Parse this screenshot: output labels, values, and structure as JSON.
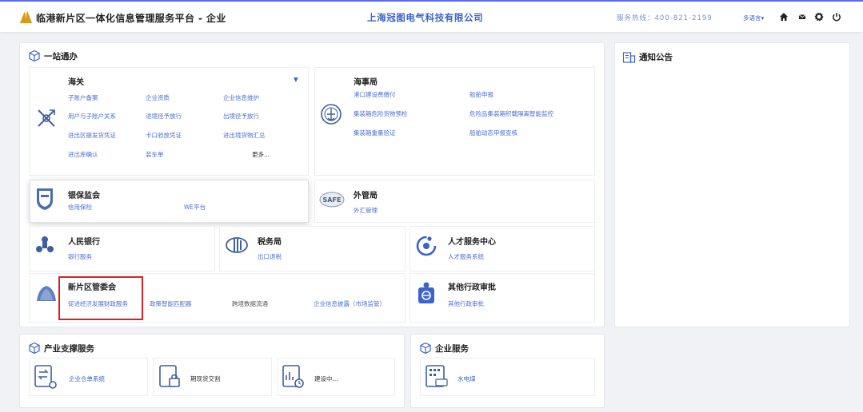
{
  "header": {
    "platform_title": "临港新片区一体化信息管理服务平台 - 企业",
    "company_name": "上海冠图电气科技有限公司",
    "hotline": "服务热线：400-821-2199",
    "language": "多语言▾",
    "icons": [
      "home-icon",
      "mail-icon",
      "settings-icon",
      "power-icon"
    ]
  },
  "one_stop": {
    "title": "一站通办",
    "customs": {
      "title": "海关",
      "links": [
        "子账户备案",
        "企业资质",
        "企业信息维护",
        "用户与子账户关系",
        "进境径予放行",
        "出境径予放行",
        "进出区提发货凭证",
        "卡口验放凭证",
        "进出境货物汇总",
        "进出库确认",
        "装车单"
      ],
      "more": "更多..."
    },
    "maritime": {
      "title": "海事局",
      "links": [
        "港口建设费缴付",
        "船舶申报",
        "集装箱危险货物预检",
        "危险品集装箱积载隔离智能监控",
        "集装箱重量验证",
        "船舶动态申报查核"
      ]
    },
    "banking": {
      "title": "银保监会",
      "links": [
        "信用保险",
        "WE平台"
      ]
    },
    "forex": {
      "title": "外管局",
      "links": [
        "外汇管理"
      ]
    },
    "pboc": {
      "title": "人民银行",
      "links": [
        "银行服务"
      ]
    },
    "tax": {
      "title": "税务局",
      "links": [
        "出口退税"
      ]
    },
    "talent": {
      "title": "人才服务中心",
      "links": [
        "人才服务系统"
      ]
    },
    "committee": {
      "title": "新片区管委会",
      "links": [
        "促进经济发展财政服务",
        "政策智能匹配器",
        "跨境数据流通",
        "企业信息披露（市场监管）"
      ]
    },
    "other": {
      "title": "其他行政审批",
      "links": [
        "其他行政审批"
      ]
    }
  },
  "notice": {
    "title": "通知公告"
  },
  "industry": {
    "title": "产业支撑服务",
    "items": [
      {
        "label": "企业仓单系统",
        "icon": "warehouse-receipt-icon"
      },
      {
        "label": "期现货交割",
        "icon": "futures-delivery-icon"
      },
      {
        "label": "建设中...",
        "icon": "under-construction-icon"
      }
    ]
  },
  "enterprise": {
    "title": "企业服务",
    "items": [
      {
        "label": "水电煤",
        "icon": "utilities-building-icon"
      }
    ]
  },
  "colors": {
    "accent": "#3b63c9",
    "link": "#4a6fd6",
    "highlight": "#e02020",
    "topline": "#5b6cf0"
  }
}
